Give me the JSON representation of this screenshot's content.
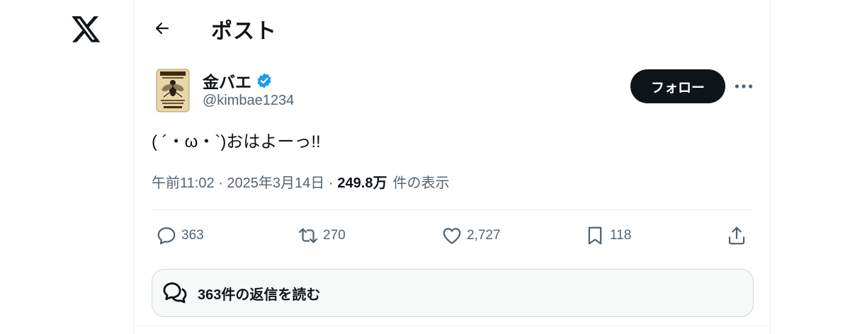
{
  "nav": {
    "logo_icon": "x-logo-icon"
  },
  "header": {
    "back_icon": "arrow-left-icon",
    "title": "ポスト"
  },
  "author": {
    "name": "金バエ",
    "verified_icon": "verified-badge-icon",
    "handle": "@kimbae1234",
    "avatar_icon": "wanted-poster-fly-avatar"
  },
  "follow_button": {
    "label": "フォロー"
  },
  "more_icon": "more-horizontal-icon",
  "post": {
    "text": "( ´・ω・`)おはよーっ!!"
  },
  "meta": {
    "timestamp": "午前11:02 · 2025年3月14日 ·",
    "views_count": "249.8万",
    "views_label": "件の表示"
  },
  "actions": {
    "reply_count": "363",
    "retweet_count": "270",
    "like_count": "2,727",
    "bookmark_count": "118"
  },
  "replies_banner": {
    "label": "363件の返信を読む"
  },
  "colors": {
    "text": "#0f1419",
    "secondary": "#536471",
    "verified": "#1d9bf0",
    "follow_bg": "#0f1419",
    "banner_bg": "#f7f9f9"
  }
}
